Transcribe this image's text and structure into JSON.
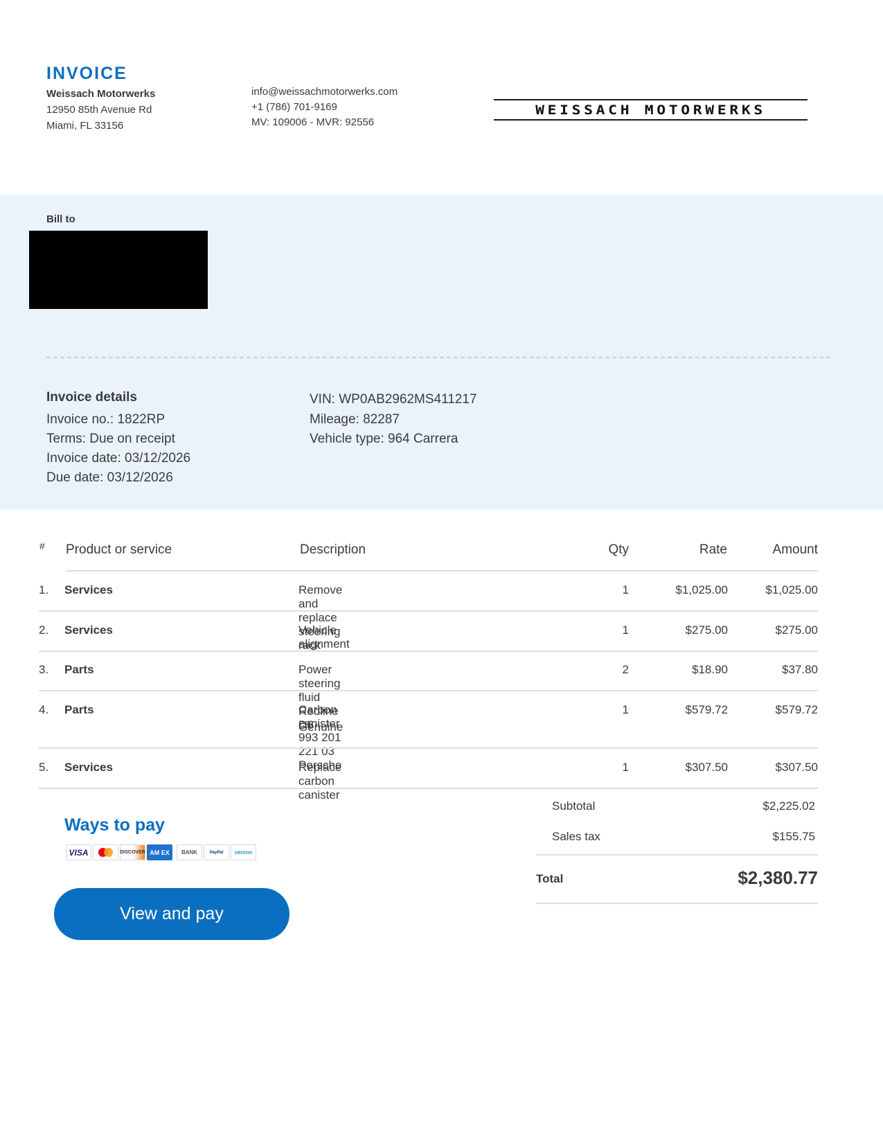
{
  "header": {
    "title": "INVOICE",
    "company_name": "Weissach Motorwerks",
    "address_line1": "12950 85th Avenue Rd",
    "address_line2": "Miami, FL 33156",
    "email": "info@weissachmotorwerks.com",
    "phone": "+1 (786) 701-9169",
    "license": "MV: 109006 - MVR: 92556",
    "logo_text": "WEISSACH MOTORWERKS"
  },
  "bill_to": {
    "label": "Bill to"
  },
  "invoice_details": {
    "title": "Invoice details",
    "invoice_no": "Invoice no.: 1822RP",
    "terms": "Terms: Due on receipt",
    "invoice_date": "Invoice date: 03/12/2026",
    "due_date": "Due date: 03/12/2026"
  },
  "vehicle": {
    "vin": "VIN: WP0AB2962MS411217",
    "mileage": "Mileage: 82287",
    "type": "Vehicle type: 964 Carrera"
  },
  "table": {
    "headers": {
      "num": "#",
      "product": "Product or service",
      "description": "Description",
      "qty": "Qty",
      "rate": "Rate",
      "amount": "Amount"
    },
    "rows": [
      {
        "num": "1.",
        "product": "Services",
        "description": "Remove and replace steering rack",
        "description2": "",
        "qty": "1",
        "rate": "$1,025.00",
        "amount": "$1,025.00"
      },
      {
        "num": "2.",
        "product": "Services",
        "description": "Vehicle alignment",
        "description2": "",
        "qty": "1",
        "rate": "$275.00",
        "amount": "$275.00"
      },
      {
        "num": "3.",
        "product": "Parts",
        "description": "Power steering fluid Redline D6",
        "description2": "",
        "qty": "2",
        "rate": "$18.90",
        "amount": "$37.80"
      },
      {
        "num": "4.",
        "product": "Parts",
        "description": "Carbon canister 993 201 221 03 Porsche",
        "description2": "Genuine",
        "qty": "1",
        "rate": "$579.72",
        "amount": "$579.72"
      },
      {
        "num": "5.",
        "product": "Services",
        "description": "Replace carbon canister",
        "description2": "",
        "qty": "1",
        "rate": "$307.50",
        "amount": "$307.50"
      }
    ]
  },
  "payment": {
    "title": "Ways to pay",
    "methods": [
      "VISA",
      "mastercard",
      "DISCOVER",
      "AM EX",
      "BANK",
      "PayPal",
      "venmo"
    ],
    "button_label": "View and pay",
    "button_color": "#0a6fc0"
  },
  "totals": {
    "subtotal_label": "Subtotal",
    "subtotal": "$2,225.02",
    "tax_label": "Sales tax",
    "tax": "$155.75",
    "total_label": "Total",
    "total": "$2,380.77"
  },
  "colors": {
    "accent": "#0a6fc0",
    "band": "#ebf3fa",
    "text": "#393a3d"
  }
}
